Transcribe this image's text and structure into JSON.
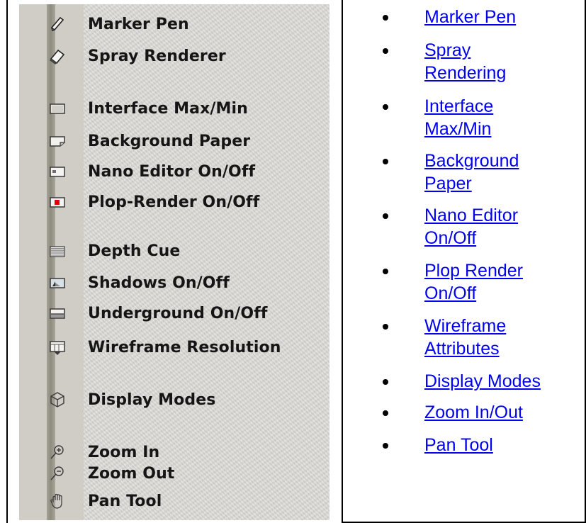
{
  "toolbar": {
    "items": [
      {
        "label": "Marker Pen",
        "icon": "marker-pen-icon"
      },
      {
        "label": "Spray Renderer",
        "icon": "spray-renderer-icon"
      },
      {
        "label": "Interface Max/Min",
        "icon": "interface-max-min-icon"
      },
      {
        "label": "Background Paper",
        "icon": "background-paper-icon"
      },
      {
        "label": "Nano Editor On/Off",
        "icon": "nano-editor-icon"
      },
      {
        "label": "Plop-Render On/Off",
        "icon": "plop-render-icon"
      },
      {
        "label": "Depth Cue",
        "icon": "depth-cue-icon"
      },
      {
        "label": "Shadows On/Off",
        "icon": "shadows-icon"
      },
      {
        "label": "Underground On/Off",
        "icon": "underground-icon"
      },
      {
        "label": "Wireframe Resolution",
        "icon": "wireframe-resolution-icon"
      },
      {
        "label": "Display Modes",
        "icon": "display-modes-icon"
      },
      {
        "label": "Zoom In",
        "icon": "zoom-in-icon"
      },
      {
        "label": "Zoom Out",
        "icon": "zoom-out-icon"
      },
      {
        "label": "Pan Tool",
        "icon": "pan-tool-icon"
      }
    ]
  },
  "links": {
    "items": [
      {
        "line1": "Marker Pen",
        "line2": ""
      },
      {
        "line1": "Spray",
        "line2": "Rendering"
      },
      {
        "line1": "Interface",
        "line2": "Max/Min"
      },
      {
        "line1": "Background",
        "line2": "Paper"
      },
      {
        "line1": "Nano Editor",
        "line2": "On/Off"
      },
      {
        "line1": "Plop Render",
        "line2": "On/Off"
      },
      {
        "line1": "Wireframe",
        "line2": "Attributes"
      },
      {
        "line1": "Display Modes",
        "line2": ""
      },
      {
        "line1": "Zoom In/Out",
        "line2": ""
      },
      {
        "line1": "Pan Tool",
        "line2": ""
      }
    ]
  },
  "colors": {
    "link": "#0000ee",
    "panel": "#d9d7d2",
    "label": "#151515",
    "record": "#e00000"
  }
}
